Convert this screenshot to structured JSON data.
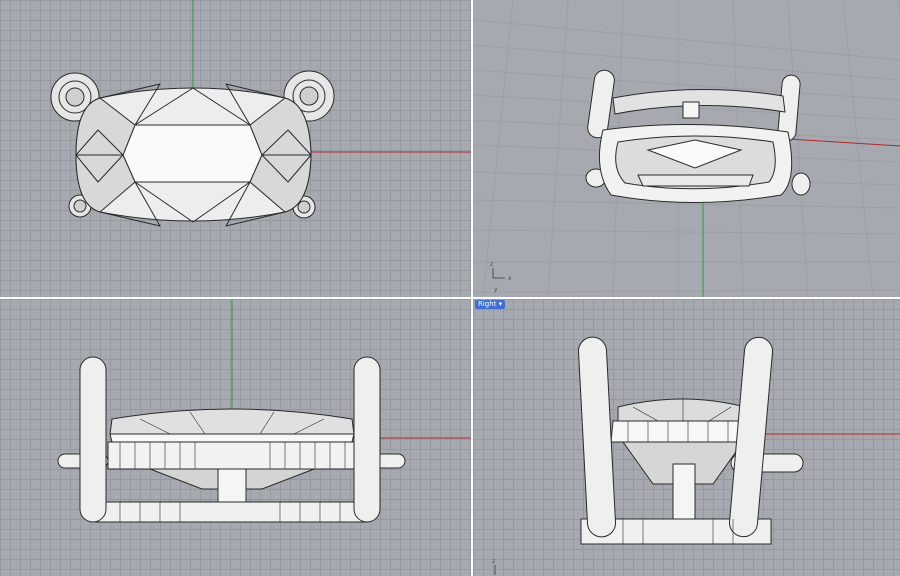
{
  "viewports": {
    "right": {
      "tab_label": "Right ▾"
    }
  },
  "axis_labels": {
    "z": "z",
    "x": "x",
    "y": "y"
  },
  "colors": {
    "viewport_bg": "#a6aab0",
    "grid_minor": "#959aa0",
    "x_axis": "#b8252b",
    "y_axis": "#2b9a3a",
    "active_tab": "#3f6fd6",
    "model_fill": "#f2f2f2",
    "model_line": "#2a2a2a"
  }
}
